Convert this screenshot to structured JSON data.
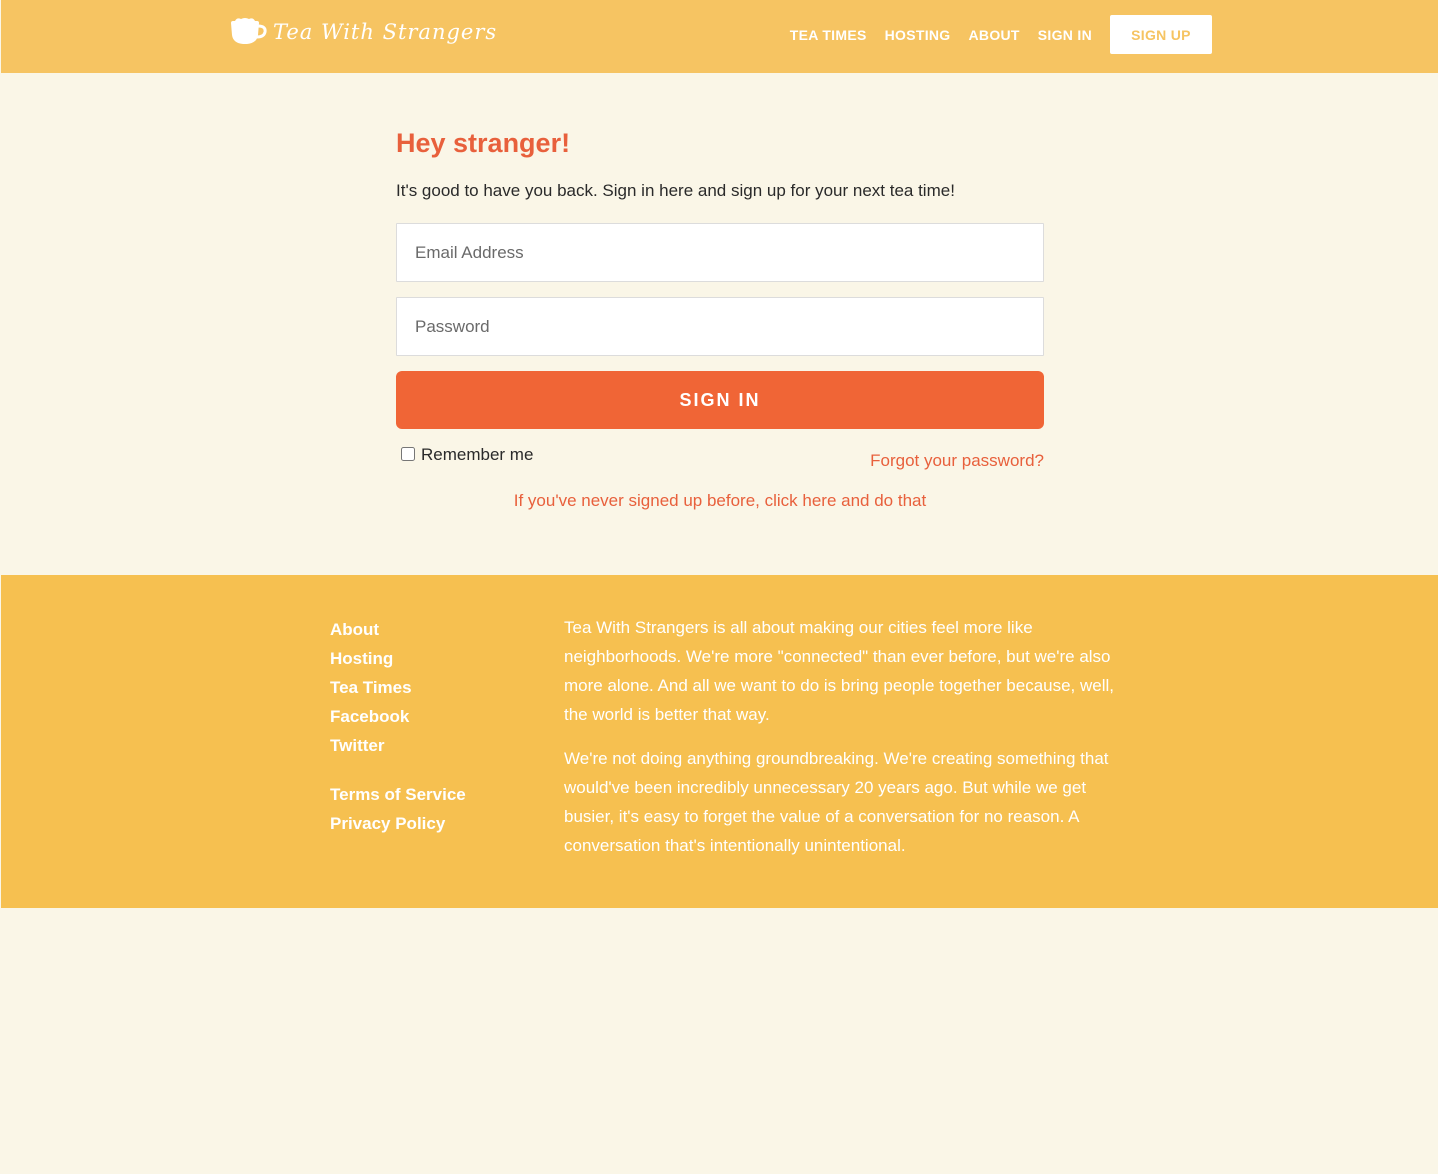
{
  "header": {
    "logo_text": "Tea With Strangers",
    "logo_icon": "teacup-icon",
    "nav": [
      "TEA TIMES",
      "HOSTING",
      "ABOUT",
      "SIGN IN"
    ],
    "signup_label": "SIGN UP"
  },
  "main": {
    "title": "Hey stranger!",
    "intro": "It's good to have you back. Sign in here and sign up for your next tea time!",
    "email_placeholder": "Email Address",
    "email_value": "",
    "password_placeholder": "Password",
    "password_value": "",
    "signin_label": "SIGN IN",
    "remember_label": "Remember me",
    "remember_checked": false,
    "forgot_label": "Forgot your password?",
    "never_label": "If you've never signed up before, click here and do that"
  },
  "footer": {
    "links": [
      "About",
      "Hosting",
      "Tea Times",
      "Facebook",
      "Twitter"
    ],
    "legal": [
      "Terms of Service",
      "Privacy Policy"
    ],
    "paragraphs": [
      "Tea With Strangers is all about making our cities feel more like neighborhoods. We're more \"connected\" than ever before, but we're also more alone. And all we want to do is bring people together because, well, the world is better that way.",
      "We're not doing anything groundbreaking. We're creating something that would've been incredibly unnecessary 20 years ago. But while we get busier, it's easy to forget the value of a conversation for no reason. A conversation that's intentionally unintentional."
    ]
  },
  "colors": {
    "header_bg": "#f6c462",
    "footer_bg": "#f6c050",
    "page_bg": "#faf6e7",
    "accent": "#f06536",
    "title": "#e8603c"
  }
}
